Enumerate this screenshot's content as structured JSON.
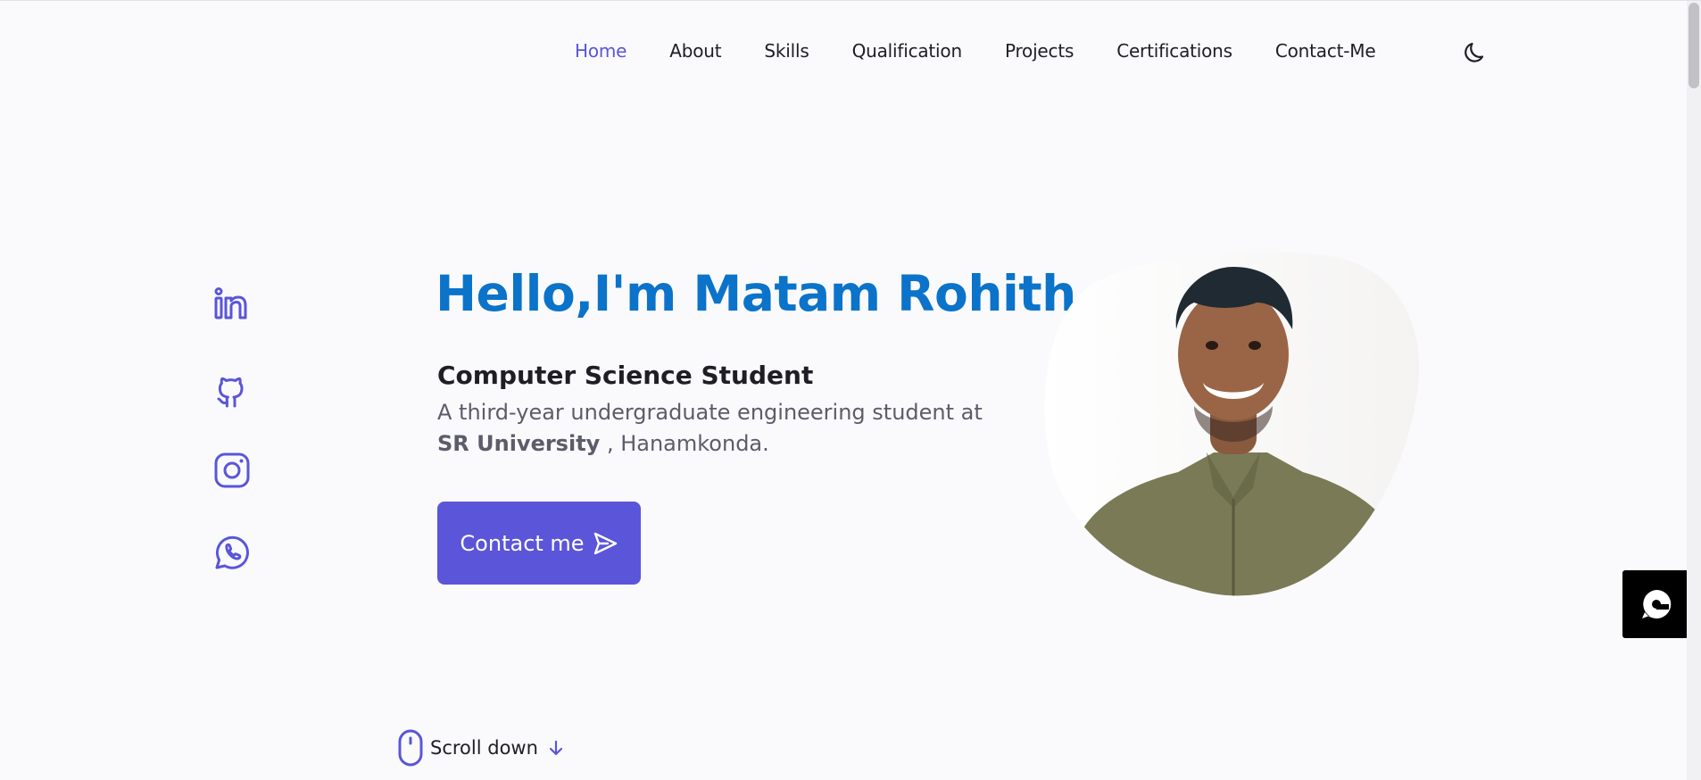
{
  "nav": {
    "items": [
      {
        "label": "Home",
        "active": true
      },
      {
        "label": "About"
      },
      {
        "label": "Skills"
      },
      {
        "label": "Qualification"
      },
      {
        "label": "Projects"
      },
      {
        "label": "Certifications"
      },
      {
        "label": "Contact-Me"
      }
    ],
    "theme_toggle_icon": "moon-icon"
  },
  "social": [
    "linkedin-icon",
    "github-icon",
    "instagram-icon",
    "whatsapp-icon"
  ],
  "hero": {
    "title": "Hello,I'm Matam Rohith",
    "subtitle": "Computer Science Student",
    "desc_prefix": "A third-year undergraduate engineering student at",
    "desc_bold": "SR University",
    "desc_suffix": " , Hanamkonda.",
    "cta_label": "Contact me",
    "cta_icon": "send-icon"
  },
  "scroll": {
    "label": "Scroll down",
    "icon": "mouse-icon"
  },
  "colors": {
    "accent": "#5a55d9",
    "title": "#0b73c9",
    "bg": "#fafafc"
  }
}
